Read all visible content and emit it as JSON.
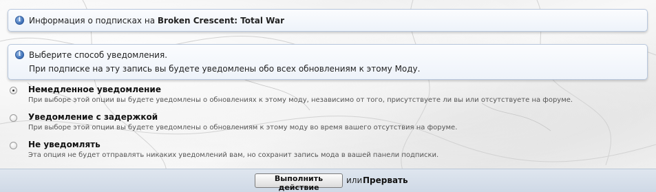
{
  "notice_title": {
    "prefix": "Информация о подписках на",
    "subject": "Broken Crescent: Total War",
    "icon": "info-icon"
  },
  "notice_method": {
    "line1": "Выберите способ уведомления.",
    "line2": "При подписке на эту запись вы будете уведомлены обо всех обновлениям к этому Моду.",
    "icon": "info-icon"
  },
  "options": [
    {
      "title": "Немедленное уведомление",
      "description": "При выборе этой опции вы будете уведомлены о обновлениях к этому моду, независимо от того, присутствуете ли вы или отсутствуете на форуме.",
      "checked": true
    },
    {
      "title": "Уведомление с задержкой",
      "description": "При выборе этой опции вы будете уведомлены о обновлениям к этому моду во время вашего отсутствия на форуме.",
      "checked": false
    },
    {
      "title": "Не уведомлять",
      "description": "Эта опция не будет отправлять никаких уведомлений вам, но сохранит запись мода в вашей панели подписки.",
      "checked": false
    }
  ],
  "actions": {
    "submit_label": "Выполнить действие",
    "or_text": "или",
    "cancel_label": "Прервать"
  },
  "colors": {
    "notice_border": "#b7c6dc",
    "action_bar": "#d5dee9"
  }
}
